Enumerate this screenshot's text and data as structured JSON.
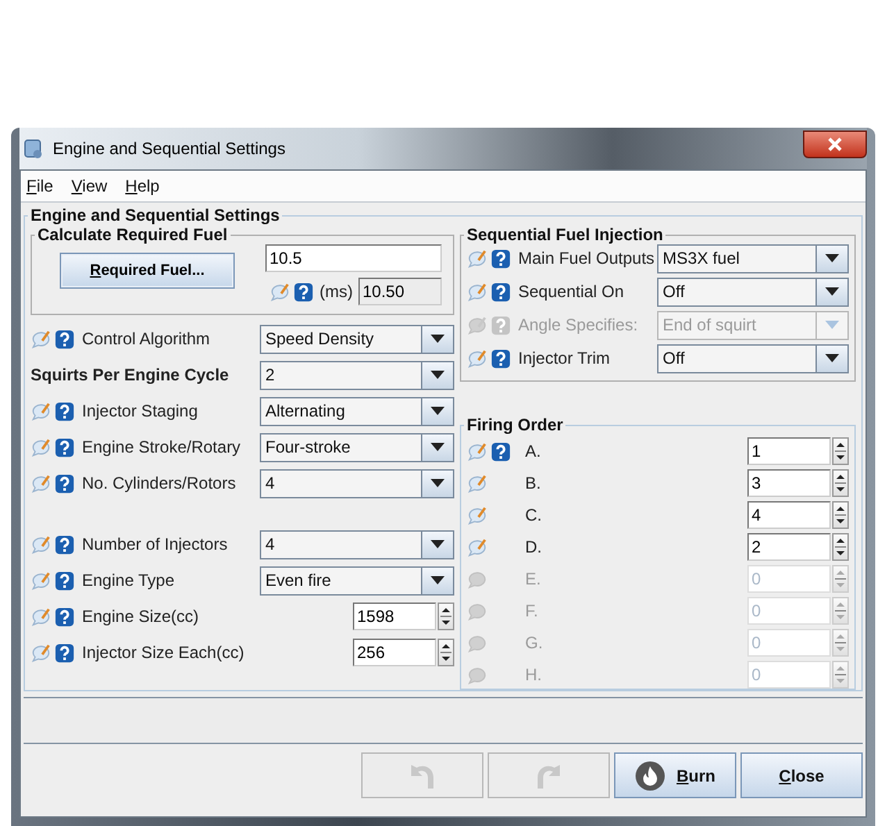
{
  "window": {
    "title": "Engine and Sequential Settings"
  },
  "menu": [
    "File",
    "View",
    "Help"
  ],
  "panel_title": "Engine and Sequential Settings",
  "calc": {
    "title": "Calculate Required Fuel",
    "button": "Required Fuel...",
    "value": "10.5",
    "unit": "(ms)",
    "result": "10.50"
  },
  "settings": [
    {
      "label": "Control Algorithm",
      "kind": "combo",
      "value": "Speed Density",
      "icons": true,
      "bold": false
    },
    {
      "label": "Squirts Per Engine Cycle",
      "kind": "combo",
      "value": "2",
      "icons": false,
      "bold": true
    },
    {
      "label": "Injector Staging",
      "kind": "combo",
      "value": "Alternating",
      "icons": true,
      "bold": false
    },
    {
      "label": "Engine Stroke/Rotary",
      "kind": "combo",
      "value": "Four-stroke",
      "icons": true,
      "bold": false
    },
    {
      "label": "No. Cylinders/Rotors",
      "kind": "combo",
      "value": "4",
      "icons": true,
      "bold": false
    }
  ],
  "injector_settings": [
    {
      "label": "Number of Injectors",
      "kind": "combo",
      "value": "4",
      "icons": true,
      "bold": false
    },
    {
      "label": "Engine Type",
      "kind": "combo",
      "value": "Even fire",
      "icons": true,
      "bold": false
    },
    {
      "label": "Engine Size(cc)",
      "kind": "spinner",
      "value": "1598",
      "icons": true,
      "bold": false
    },
    {
      "label": "Injector Size Each(cc)",
      "kind": "spinner",
      "value": "256",
      "icons": true,
      "bold": false
    }
  ],
  "sequential": {
    "title": "Sequential Fuel Injection",
    "rows": [
      {
        "label": "Main Fuel Outputs",
        "value": "MS3X fuel",
        "disabled": false
      },
      {
        "label": "Sequential On",
        "value": "Off",
        "disabled": false
      },
      {
        "label": "Angle Specifies:",
        "value": "End of squirt",
        "disabled": true
      },
      {
        "label": "Injector Trim",
        "value": "Off",
        "disabled": false
      }
    ]
  },
  "firing_order": {
    "title": "Firing Order",
    "rows": [
      {
        "label": "A.",
        "value": "1",
        "disabled": false,
        "help": true
      },
      {
        "label": "B.",
        "value": "3",
        "disabled": false,
        "help": false
      },
      {
        "label": "C.",
        "value": "4",
        "disabled": false,
        "help": false
      },
      {
        "label": "D.",
        "value": "2",
        "disabled": false,
        "help": false
      },
      {
        "label": "E.",
        "value": "0",
        "disabled": true,
        "help": false
      },
      {
        "label": "F.",
        "value": "0",
        "disabled": true,
        "help": false
      },
      {
        "label": "G.",
        "value": "0",
        "disabled": true,
        "help": false
      },
      {
        "label": "H.",
        "value": "0",
        "disabled": true,
        "help": false
      }
    ]
  },
  "buttons": [
    {
      "kind": "undo",
      "disabled": true
    },
    {
      "kind": "redo",
      "disabled": true
    },
    {
      "kind": "burn",
      "label": "Burn",
      "disabled": false
    },
    {
      "kind": "close",
      "label": "Close",
      "disabled": false
    }
  ]
}
